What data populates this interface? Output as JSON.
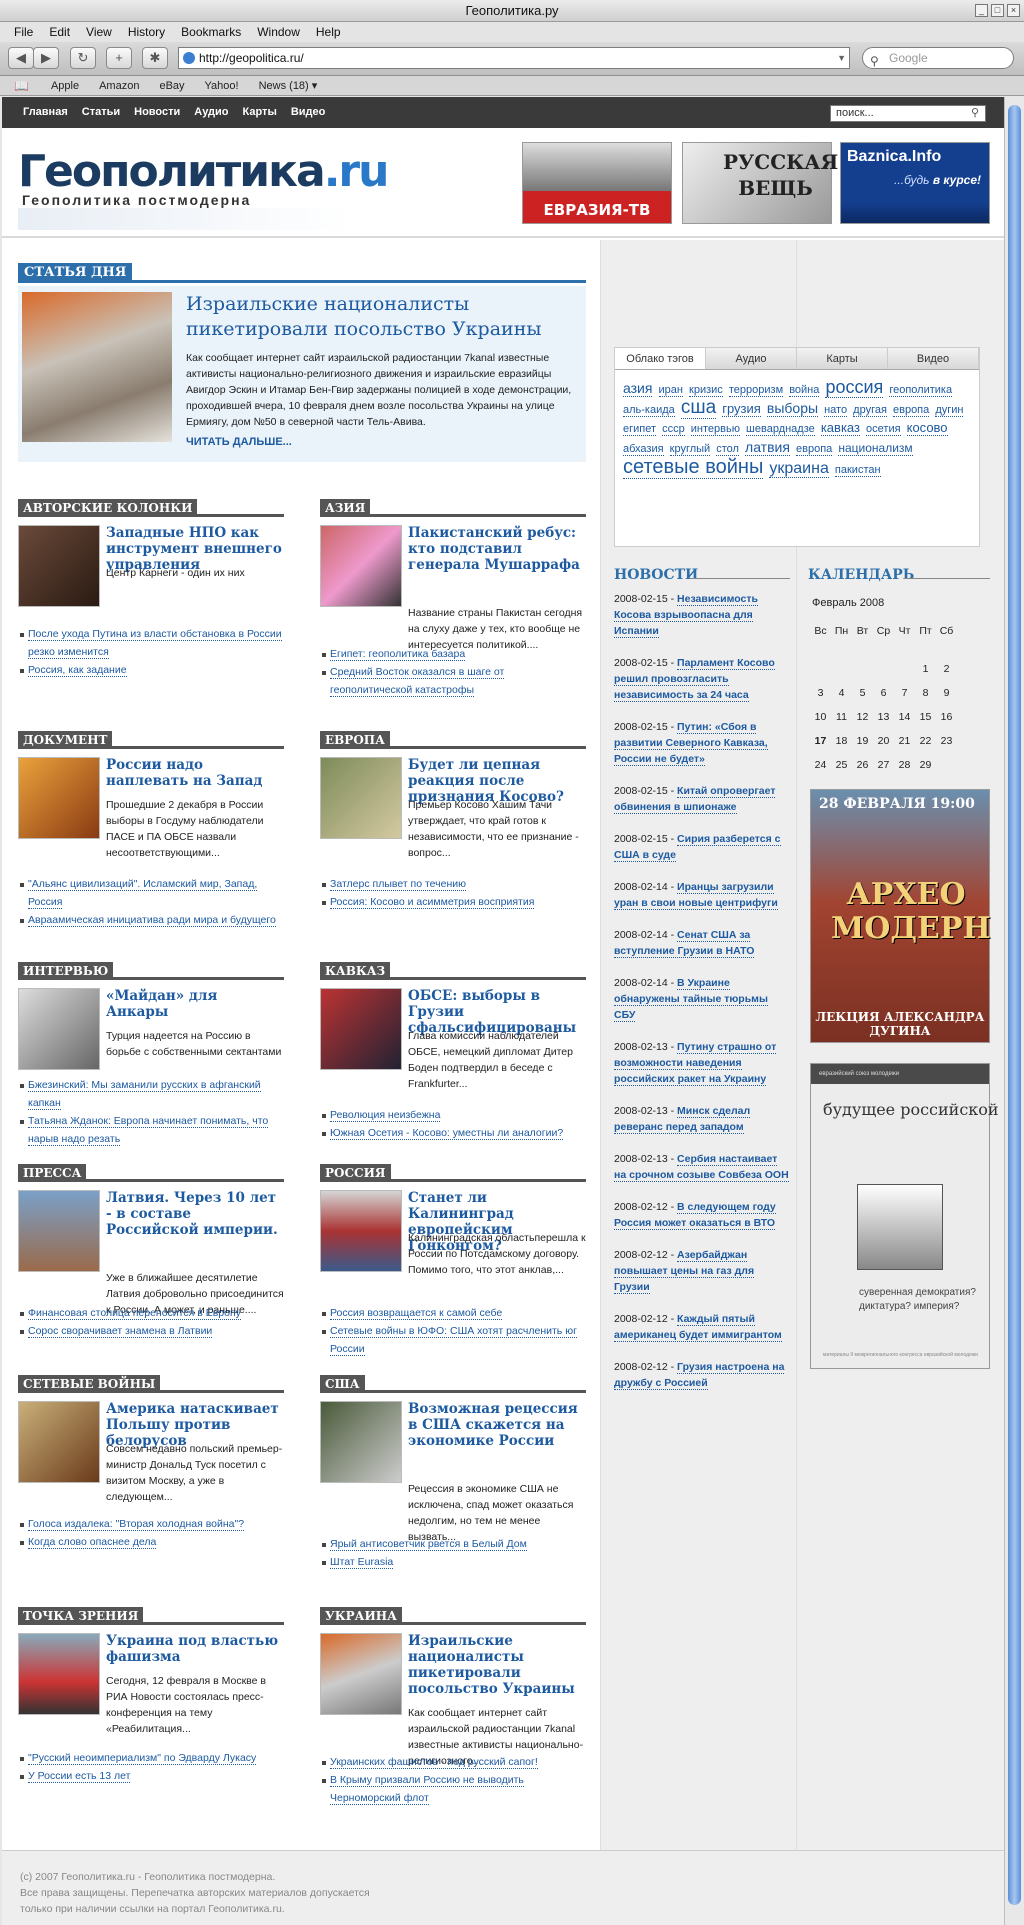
{
  "window": {
    "title": "Геополитика.ру",
    "controls": [
      "_",
      "□",
      "×"
    ]
  },
  "menu": [
    "File",
    "Edit",
    "View",
    "History",
    "Bookmarks",
    "Window",
    "Help"
  ],
  "toolbar": {
    "back": "◀",
    "forward": "▶",
    "reload": "↻",
    "add": "+",
    "bug": "✱",
    "url": "http://geopolitica.ru/",
    "search_placeholder": "Google"
  },
  "bookmarks": {
    "icon": "📖",
    "items": [
      "Apple",
      "Amazon",
      "eBay",
      "Yahoo!",
      "News (18) ▾"
    ]
  },
  "nav": {
    "items": [
      "Главная",
      "Статьи",
      "Новости",
      "Аудио",
      "Карты",
      "Видео"
    ],
    "search_placeholder": "поиск..."
  },
  "logo": {
    "main": "Геополитика",
    "ru": ".ru",
    "sub": "Геополитика постмодерна"
  },
  "banners": {
    "b1": "ЕВРАЗИЯ-ТВ",
    "b2": "РУССКАЯ ВЕЩЬ",
    "b3_title": "Baznica.Info",
    "b3_sub_pre": "...будь ",
    "b3_sub_bold": "в курсе!"
  },
  "featured": {
    "header": "СТАТЬЯ ДНЯ",
    "title": "Израильские националисты пикетировали посольство Украины",
    "text": "Как сообщает интернет сайт израильской радиостанции 7kanal известные активисты национально-религиозного движения и израильские евразийцы Авигдор Эскин и Итамар Бен-Гвир задержаны полицией в ходе демонстрации, проходившей вчера, 10 февраля днем возле посольства Украины на улице Ермиягу, дом №50 в северной части Тель-Авива.",
    "more": "ЧИТАТЬ ДАЛЬШЕ..."
  },
  "sections": [
    {
      "header": "АВТОРСКИЕ КОЛОНКИ",
      "title": "Западные НПО как инструмент внешнего управления",
      "text": "Центр Карнеги - один их них",
      "links": [
        "После ухода Путина из власти обстановка в России резко изменится",
        "Россия, как задание"
      ]
    },
    {
      "header": "АЗИЯ",
      "title": "Пакистанский ребус: кто подставил генерала Мушаррафа",
      "text": "Название страны Пакистан сегодня на слуху даже у тех, кто вообще не интересуется политикой....",
      "links": [
        "Египет: геополитика базара",
        "Средний Восток оказался в шаге от геополитической катастрофы"
      ]
    },
    {
      "header": "ДОКУМЕНТ",
      "title": "России надо наплевать на Запад",
      "text": "Прошедшие 2 декабря в России выборы в Госдуму наблюдатели ПАСЕ и ПА ОБСЕ назвали несоответствующими...",
      "links": [
        "\"Альянс цивилизаций\". Исламский мир, Запад, Россия",
        "Авраамическая инициатива ради мира и будущего"
      ]
    },
    {
      "header": "ЕВРОПА",
      "title": "Будет ли цепная реакция после признания Косово?",
      "text": "Премьер Косово Хашим Тачи утверждает, что край готов к независимости, что ее признание - вопрос...",
      "links": [
        "Затлерс плывет по течению",
        "Россия: Косово и асимметрия восприятия"
      ]
    },
    {
      "header": "ИНТЕРВЬЮ",
      "title": "«Майдан» для Анкары",
      "text": "Турция надеется на Россию в борьбе с собственными сектантами",
      "links": [
        "Бжезинский: Мы заманили русских в афганский капкан",
        "Татьяна Жданок: Европа начинает понимать, что нарыв надо резать"
      ]
    },
    {
      "header": "КАВКАЗ",
      "title": "ОБСЕ: выборы в Грузии сфальсифицированы",
      "text": "Глава комиссии наблюдателей ОБСЕ, немецкий дипломат Дитер Боден подтвердил в беседе с Frankfurter...",
      "links": [
        "Революция неизбежна",
        "Южная Осетия - Косово: уместны ли аналогии?"
      ]
    },
    {
      "header": "ПРЕССА",
      "title": "Латвия. Через 10 лет - в составе Российской империи.",
      "text": "Уже в ближайшее десятилетие Латвия добровольно присоединится к России. А может, и раньше....",
      "links": [
        "Финансовая столица переносится в Европу",
        "Сорос сворачивает знамена в Латвии"
      ]
    },
    {
      "header": "РОССИЯ",
      "title": "Станет ли Калининград европейским Гонконгом?",
      "text": "Калининградская областьперешла к России по Потсдамскому договору. Помимо того, что этот анклав,...",
      "links": [
        "Россия возвращается к самой себе",
        "Сетевые войны в ЮФО: США хотят расчленить юг России"
      ]
    },
    {
      "header": "СЕТЕВЫЕ ВОЙНЫ",
      "title": "Америка натаскивает Польшу против белорусов",
      "text": "Совсем недавно польский премьер-министр Дональд Туск посетил с визитом Москву, а уже в следующем...",
      "links": [
        "Голоса издалека: \"Вторая холодная война\"?",
        "Когда слово опаснее дела"
      ]
    },
    {
      "header": "США",
      "title": "Возможная рецессия в США скажется на экономике России",
      "text": "Рецессия в экономике США не исключена, спад может оказаться недолгим, но тем не менее вызвать...",
      "links": [
        "Ярый антисоветчик рвется в Белый Дом",
        "Штат Eurasia"
      ]
    },
    {
      "header": "ТОЧКА ЗРЕНИЯ",
      "title": "Украина под властью фашизма",
      "text": "Сегодня, 12 февраля в Москве в РИА Новости состоялась пресс-конференция на тему «Реабилитация...",
      "links": [
        "\"Русский неоимпериализм\" по Эдварду Лукасу",
        "У России есть 13 лет"
      ]
    },
    {
      "header": "УКРАИНА",
      "title": "Израильские националисты пикетировали посольство Украины",
      "text": "Как сообщает интернет сайт израильской радиостанции 7kanal известные активисты национально-религиозного...",
      "links": [
        "Украинских фашистов - под русский сапог!",
        "В Крыму призвали Россию не выводить Черноморский флот"
      ]
    }
  ],
  "tabs": [
    "Облако тэгов",
    "Аудио",
    "Карты",
    "Видео"
  ],
  "tags": [
    {
      "t": "азия",
      "s": 14
    },
    {
      "t": "иран",
      "s": 11
    },
    {
      "t": "кризис",
      "s": 11
    },
    {
      "t": "терроризм",
      "s": 11
    },
    {
      "t": "война",
      "s": 11
    },
    {
      "t": "россия",
      "s": 18
    },
    {
      "t": "геополитика",
      "s": 11
    },
    {
      "t": "аль-каида",
      "s": 11
    },
    {
      "t": "сша",
      "s": 19
    },
    {
      "t": "грузия",
      "s": 13
    },
    {
      "t": "выборы",
      "s": 14
    },
    {
      "t": "нато",
      "s": 11
    },
    {
      "t": "другая",
      "s": 11
    },
    {
      "t": "европа",
      "s": 11
    },
    {
      "t": "дугин",
      "s": 11
    },
    {
      "t": "египет",
      "s": 11
    },
    {
      "t": "ссср",
      "s": 11
    },
    {
      "t": "интервью",
      "s": 11
    },
    {
      "t": "шеварднадзе",
      "s": 11
    },
    {
      "t": "кавказ",
      "s": 13
    },
    {
      "t": "осетия",
      "s": 11
    },
    {
      "t": "косово",
      "s": 13
    },
    {
      "t": "абхазия",
      "s": 11
    },
    {
      "t": "круглый",
      "s": 11
    },
    {
      "t": "стол",
      "s": 11
    },
    {
      "t": "латвия",
      "s": 14
    },
    {
      "t": "европа",
      "s": 11
    },
    {
      "t": "национализм",
      "s": 12
    },
    {
      "t": "сетевые войны",
      "s": 20
    },
    {
      "t": "украина",
      "s": 16
    },
    {
      "t": "пакистан",
      "s": 11
    }
  ],
  "news": {
    "header": "НОВОСТИ",
    "items": [
      {
        "d": "2008-02-15 - ",
        "t": "Независимость Косова взрывоопасна для Испании"
      },
      {
        "d": "2008-02-15 - ",
        "t": "Парламент Косово решил провозгласить независимость за 24 часа"
      },
      {
        "d": "2008-02-15 - ",
        "t": "Путин: «Сбоя в развитии Северного Кавказа, России не будет»"
      },
      {
        "d": "2008-02-15 - ",
        "t": "Китай опровергает обвинения в шпионаже"
      },
      {
        "d": "2008-02-15 - ",
        "t": "Сирия разберется с США в суде"
      },
      {
        "d": "2008-02-14 - ",
        "t": "Иранцы загрузили уран в свои новые центрифуги"
      },
      {
        "d": "2008-02-14 - ",
        "t": "Сенат США за вступление Грузии в НАТО"
      },
      {
        "d": "2008-02-14 - ",
        "t": "В Украине обнаружены тайные тюрьмы СБУ"
      },
      {
        "d": "2008-02-13 - ",
        "t": "Путину страшно от возможности наведения российских ракет на Украину"
      },
      {
        "d": "2008-02-13 - ",
        "t": "Минск сделал реверанс перед западом"
      },
      {
        "d": "2008-02-13 - ",
        "t": "Сербия настаивает на срочном созыве Совбеза ООН"
      },
      {
        "d": "2008-02-12 - ",
        "t": "В следующем году Россия может оказаться в ВТО"
      },
      {
        "d": "2008-02-12 - ",
        "t": "Азербайджан повышает цены на газ для Грузии"
      },
      {
        "d": "2008-02-12 - ",
        "t": "Каждый пятый американец будет иммигрантом"
      },
      {
        "d": "2008-02-12 - ",
        "t": "Грузия настроена на дружбу с Россией"
      }
    ]
  },
  "calendar": {
    "header": "КАЛЕНДАРЬ",
    "month": "Февраль 2008",
    "days": [
      "Вс",
      "Пн",
      "Вт",
      "Ср",
      "Чт",
      "Пт",
      "Сб"
    ],
    "weeks": [
      [
        "",
        "",
        "",
        "",
        "",
        "1",
        "2"
      ],
      [
        "3",
        "4",
        "5",
        "6",
        "7",
        "8",
        "9"
      ],
      [
        "10",
        "11",
        "12",
        "13",
        "14",
        "15",
        "16"
      ],
      [
        "17",
        "18",
        "19",
        "20",
        "21",
        "22",
        "23"
      ],
      [
        "24",
        "25",
        "26",
        "27",
        "28",
        "29",
        ""
      ]
    ],
    "bold_day": "17"
  },
  "poster1": {
    "top": "28 ФЕВРАЛЯ       19:00",
    "mid": "АРХЕО МОДЕРН",
    "bot": "ЛЕКЦИЯ АЛЕКСАНДРА ДУГИНА"
  },
  "poster2": {
    "hd": "евразийский союз молодежи",
    "title": "будущее российской государственности",
    "qs": "суверенная демократия? диктатура? империя?",
    "ft": "материалы II межрегионального конгресса евразийской молодежи"
  },
  "footer": [
    "(c) 2007 Геополитика.ru - Геополитика постмодерна.",
    "Все права защищены. Перепечатка авторских материалов допускается",
    "только при наличии ссылки на портал Геополитика.ru."
  ]
}
